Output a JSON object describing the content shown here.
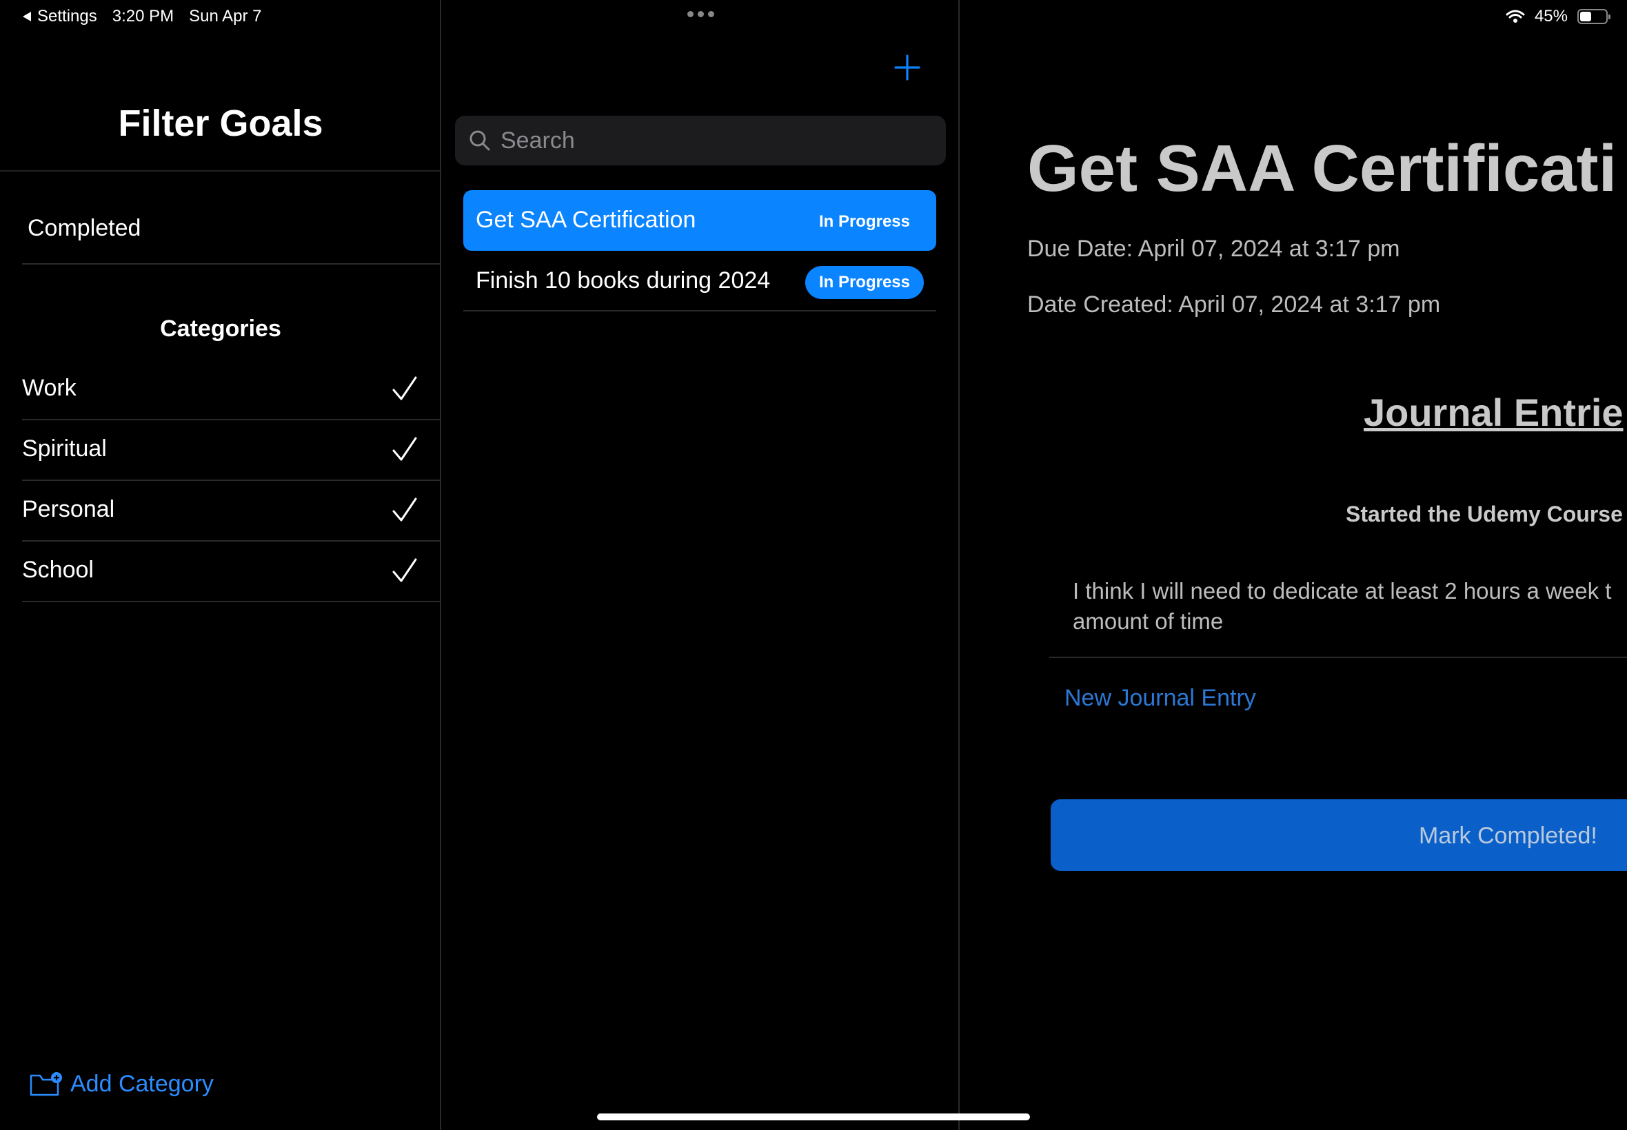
{
  "status_bar": {
    "back_label": "Settings",
    "time": "3:20 PM",
    "date": "Sun Apr 7",
    "battery_percent": "45%",
    "battery_level": 0.45
  },
  "sidebar": {
    "title": "Filter Goals",
    "completed_label": "Completed",
    "categories_heading": "Categories",
    "categories": [
      {
        "label": "Work",
        "checked": true
      },
      {
        "label": "Spiritual",
        "checked": true
      },
      {
        "label": "Personal",
        "checked": true
      },
      {
        "label": "School",
        "checked": true
      }
    ],
    "add_category_label": "Add Category"
  },
  "goal_list": {
    "search_placeholder": "Search",
    "goals": [
      {
        "title": "Get SAA Certification",
        "status": "In Progress",
        "selected": true
      },
      {
        "title": "Finish 10 books during 2024",
        "status": "In Progress",
        "selected": false
      }
    ]
  },
  "detail": {
    "title": "Get SAA Certificati",
    "due_date": "Due Date: April 07, 2024 at 3:17 pm",
    "date_created": "Date Created: April 07, 2024 at 3:17 pm",
    "journal_heading": "Journal Entrie",
    "entries": [
      {
        "title": "Started the Udemy Course",
        "body_line1": "I think I will need to dedicate at least 2 hours a week t",
        "body_line2": "amount of time"
      }
    ],
    "new_entry_label": "New Journal Entry",
    "mark_completed_label": "Mark Completed!"
  },
  "colors": {
    "accent": "#0a84ff",
    "link": "#2b8cff",
    "background": "#000000"
  }
}
